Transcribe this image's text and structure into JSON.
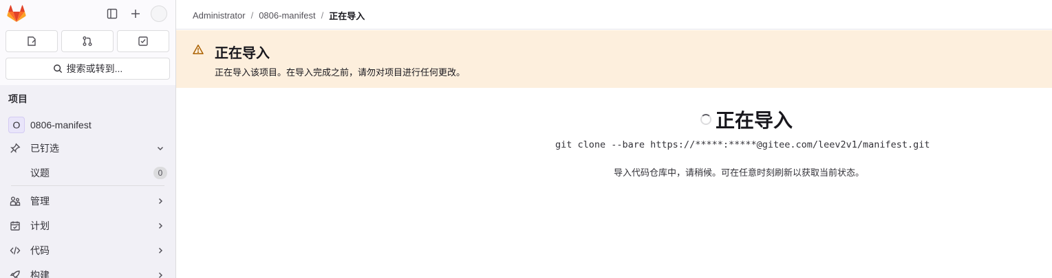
{
  "sidebar": {
    "search_label": "搜索或转到...",
    "section_title": "项目",
    "project": {
      "avatar_letter": "O",
      "name": "0806-manifest"
    },
    "pinned": {
      "label": "已钉选",
      "items": [
        {
          "label": "议题",
          "count": "0"
        }
      ]
    },
    "nav": [
      {
        "label": "管理",
        "icon": "users-icon"
      },
      {
        "label": "计划",
        "icon": "calendar-icon"
      },
      {
        "label": "代码",
        "icon": "code-icon"
      },
      {
        "label": "构建",
        "icon": "rocket-icon"
      }
    ]
  },
  "breadcrumb": {
    "items": [
      "Administrator",
      "0806-manifest"
    ],
    "current": "正在导入"
  },
  "alert": {
    "title": "正在导入",
    "body": "正在导入该项目。在导入完成之前，请勿对项目进行任何更改。"
  },
  "main": {
    "title": "正在导入",
    "command": "git clone --bare https://*****:*****@gitee.com/leev2v1/manifest.git",
    "status": "导入代码仓库中，请稍候。可在任意时刻刷新以获取当前状态。"
  },
  "colors": {
    "alert_bg": "#fdefdd",
    "warning_icon": "#ab6100",
    "logo_orange": "#fc6d26",
    "logo_red": "#e24329",
    "logo_light": "#fca326"
  }
}
